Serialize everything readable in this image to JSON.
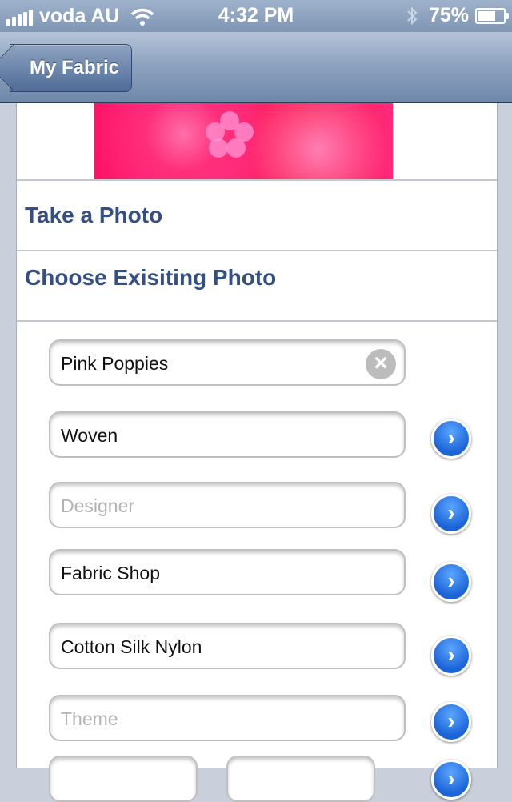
{
  "status_bar": {
    "carrier": "voda AU",
    "time": "4:32 PM",
    "battery_percent": "75%",
    "battery_level": 0.75
  },
  "nav": {
    "back_label": "My Fabric"
  },
  "actions": {
    "take_photo": "Take a Photo",
    "choose_photo": "Choose Exisiting Photo"
  },
  "fields": {
    "name": {
      "value": "Pink Poppies",
      "placeholder": ""
    },
    "type": {
      "value": "Woven",
      "placeholder": ""
    },
    "designer": {
      "value": "",
      "placeholder": "Designer"
    },
    "shop": {
      "value": "Fabric Shop",
      "placeholder": ""
    },
    "content": {
      "value": "Cotton Silk Nylon",
      "placeholder": ""
    },
    "theme": {
      "value": "",
      "placeholder": "Theme"
    }
  },
  "icons": {
    "clear": "clear-icon",
    "disclosure": "chevron-right-icon",
    "signal": "signal-bars-icon",
    "wifi": "wifi-icon",
    "bluetooth": "bluetooth-icon",
    "battery": "battery-icon"
  },
  "colors": {
    "accent_text": "#344f84",
    "nav_bar": "#8ba0bd",
    "disclosure_blue": "#1b63d6",
    "fabric_pink": "#ff1467"
  }
}
